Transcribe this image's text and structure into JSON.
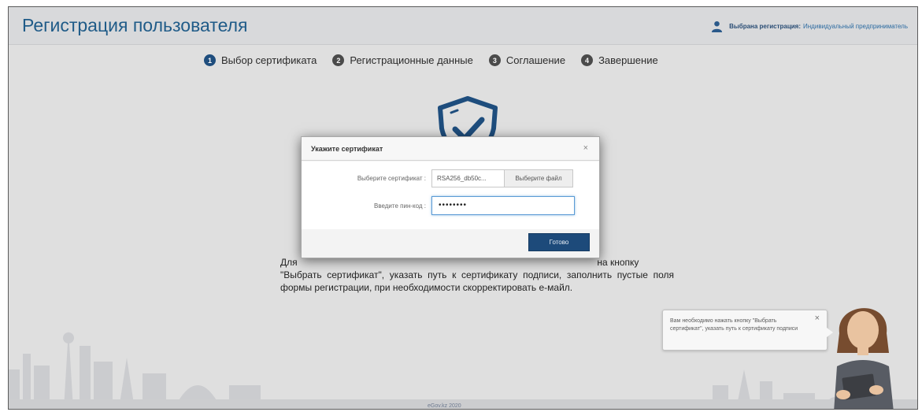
{
  "header": {
    "title": "Регистрация пользователя",
    "registration_label": "Выбрана регистрация:",
    "registration_value": "Индивидуальный предприниматель"
  },
  "steps": [
    {
      "num": "1",
      "label": "Выбор сертификата"
    },
    {
      "num": "2",
      "label": "Регистрационные данные"
    },
    {
      "num": "3",
      "label": "Соглашение"
    },
    {
      "num": "4",
      "label": "Завершение"
    }
  ],
  "instruction": {
    "line1_prefix": "Для",
    "line1_suffix": "на кнопку",
    "rest": "\"Выбрать сертификат\", указать путь к сертификату подписи, заполнить пустые поля формы регистрации, при необходимости скорректировать е-майл."
  },
  "dialog": {
    "title": "Укажите сертификат",
    "close": "×",
    "cert_label": "Выберите сертификат :",
    "cert_value": "RSA256_db50c...",
    "choose_file": "Выберите файл",
    "pin_label": "Введите пин-код :",
    "pin_value": "••••••••",
    "done": "Готово"
  },
  "assistant": {
    "message": "Вам необходимо нажать кнопку \"Выбрать сертификат\", указать путь к сертификату подписи",
    "close": "×"
  },
  "footer": {
    "text": "eGov.kz 2020"
  },
  "colors": {
    "accent": "#1e4f80",
    "title": "#1f5d8c",
    "background": "#e6e6e6"
  }
}
